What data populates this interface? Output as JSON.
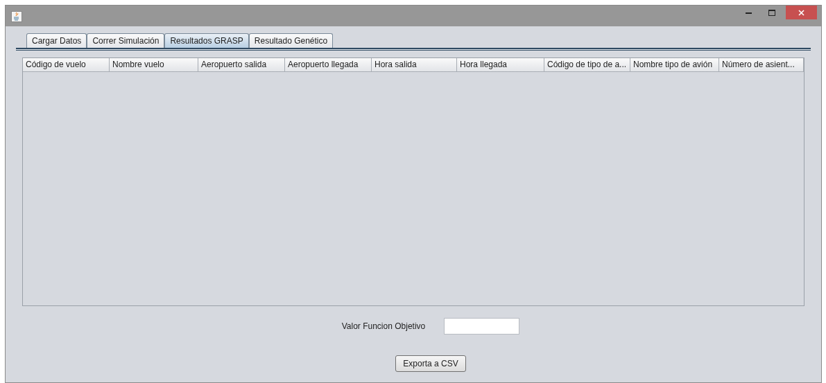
{
  "window": {
    "title_controls": [
      {
        "kind": "minimize"
      },
      {
        "kind": "maximize"
      },
      {
        "kind": "close"
      }
    ]
  },
  "tabs": [
    {
      "label": "Cargar Datos",
      "selected": false
    },
    {
      "label": "Correr Simulación",
      "selected": false
    },
    {
      "label": "Resultados GRASP",
      "selected": true
    },
    {
      "label": "Resultado Genético",
      "selected": false
    }
  ],
  "table": {
    "columns": [
      "Código de vuelo",
      "Nombre vuelo",
      "Aeropuerto salida",
      "Aeropuerto llegada",
      "Hora salida",
      "Hora llegada",
      "Código de tipo de a...",
      "Nombre tipo de avión",
      "Número de asient..."
    ]
  },
  "objective_field": {
    "label": "Valor Funcion Objetivo"
  },
  "buttons": [
    "Exporta a CSV"
  ]
}
